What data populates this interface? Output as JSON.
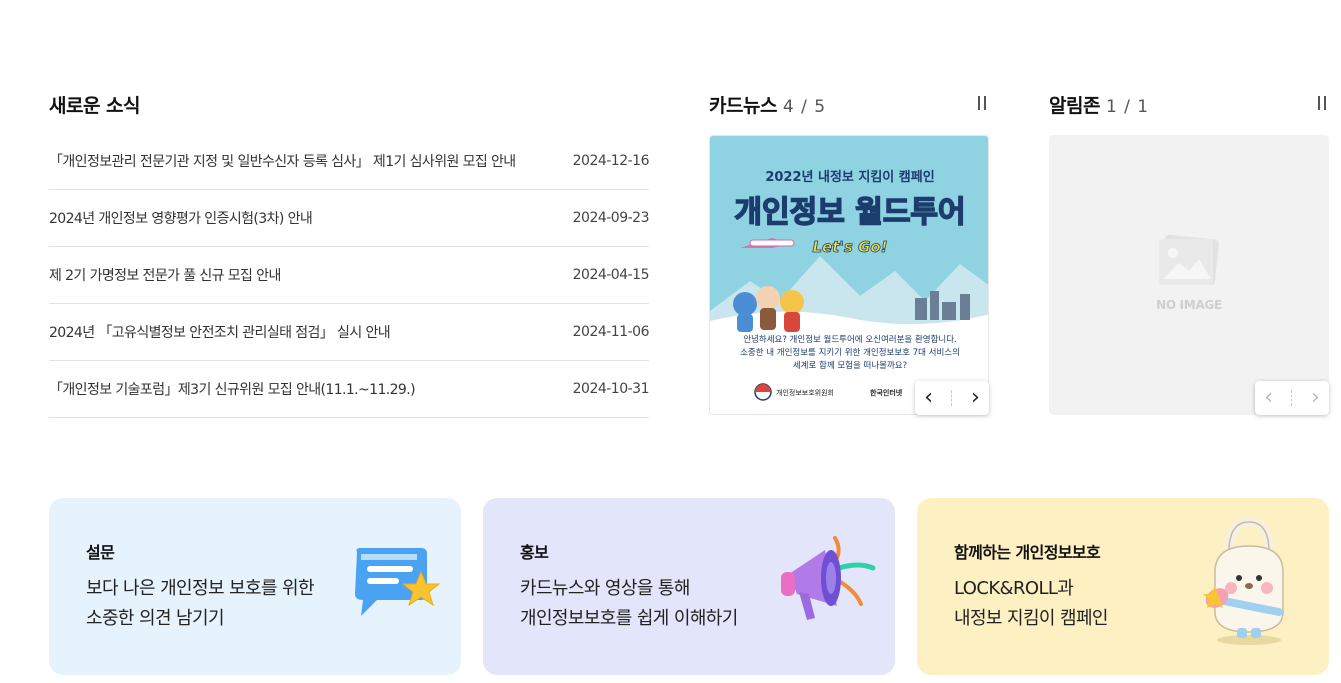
{
  "news": {
    "title": "새로운 소식",
    "items": [
      {
        "title": "「개인정보관리 전문기관 지정 및 일반수신자 등록 심사」 제1기 심사위원 모집 안내",
        "date": "2024-12-16"
      },
      {
        "title": "2024년 개인정보 영향평가 인증시험(3차) 안내",
        "date": "2024-09-23"
      },
      {
        "title": "제 2기 가명정보 전문가 풀 신규 모집 안내",
        "date": "2024-04-15"
      },
      {
        "title": "2024년 「고유식별정보 안전조치 관리실태 점검」 실시 안내",
        "date": "2024-11-06"
      },
      {
        "title": "「개인정보 기술포럼」제3기 신규위원 모집 안내(11.1.~11.29.)",
        "date": "2024-10-31"
      }
    ]
  },
  "cardnews": {
    "title": "카드뉴스",
    "counter": "4 / 5",
    "card": {
      "headline": "2022년 내정보 지킴이 캠페인",
      "big_title": "개인정보 월드투어",
      "badge": "Let's Go!",
      "body_line1": "안녕하세요? 개인정보 월드투어에 오신여러분을 환영합니다.",
      "body_line2": "소중한 내 개인정보를 지키기 위한 개인정보보호 7대 서비스의",
      "body_line3": "세계로 함께 모험을 떠나볼까요?",
      "logo1": "개인정보보호위원회",
      "logo2": "한국인터넷"
    },
    "prev": "‹",
    "next": "›"
  },
  "alert": {
    "title": "알림존",
    "counter": "1 / 1",
    "noimage": "NO IMAGE",
    "prev": "‹",
    "next": "›"
  },
  "banners": [
    {
      "label": "설문",
      "line1": "보다 나은 개인정보 보호를 위한",
      "line2": "소중한 의견 남기기",
      "bg": "#e6f3fd"
    },
    {
      "label": "홍보",
      "line1": "카드뉴스와 영상을 통해",
      "line2": "개인정보보호를 쉽게 이해하기",
      "bg": "#e3e5fb"
    },
    {
      "label": "함께하는 개인정보보호",
      "line1": "LOCK&ROLL과",
      "line2": "내정보 지킴이 캠페인",
      "bg": "#fdf0c2"
    }
  ]
}
